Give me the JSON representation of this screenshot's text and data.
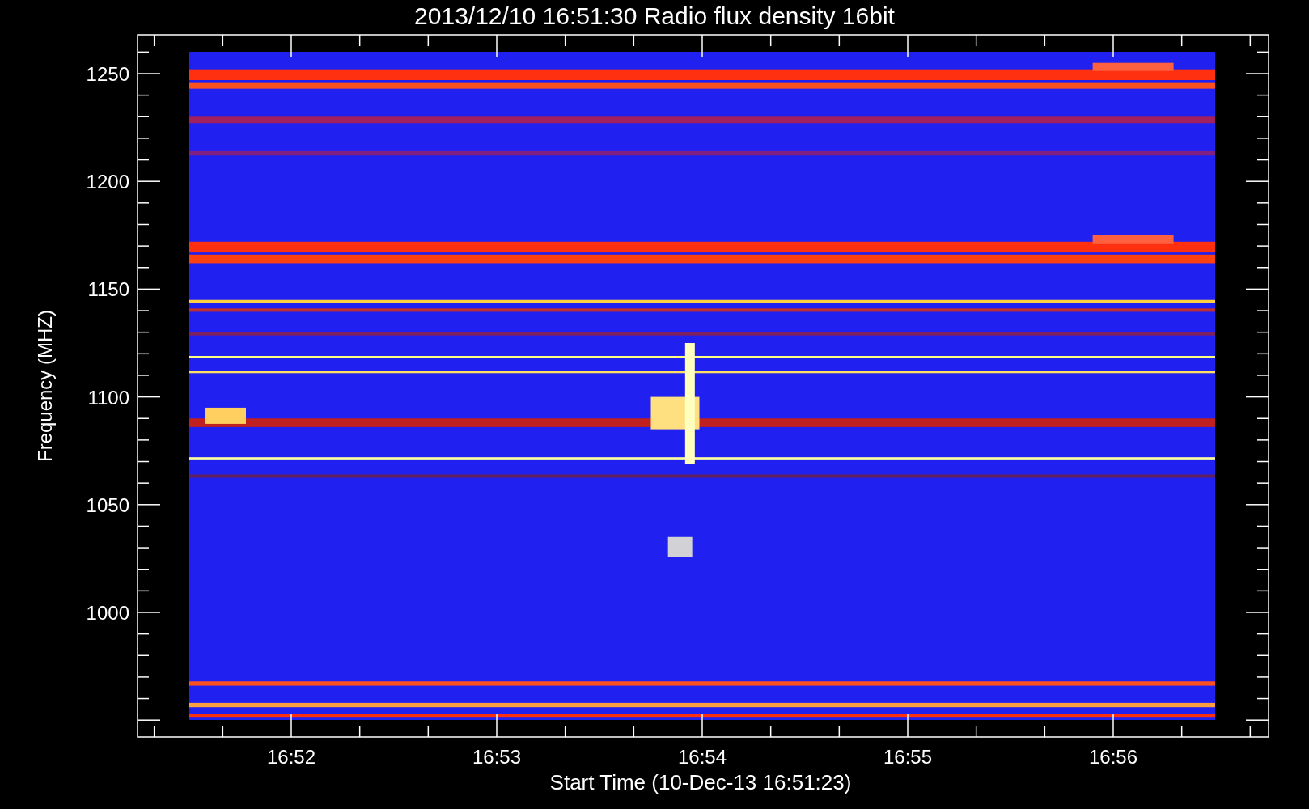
{
  "plot": {
    "title": "2013/12/10 16:51:30 Radio flux density 16bit",
    "ylabel": "Frequency (MHZ)",
    "xlabel": "Start Time (10-Dec-13 16:51:23)",
    "yticks": [
      "1250",
      "1200",
      "1150",
      "1100",
      "1050",
      "1000"
    ],
    "xticks": [
      "16:52",
      "16:53",
      "16:54",
      "16:55",
      "16:56"
    ]
  }
}
